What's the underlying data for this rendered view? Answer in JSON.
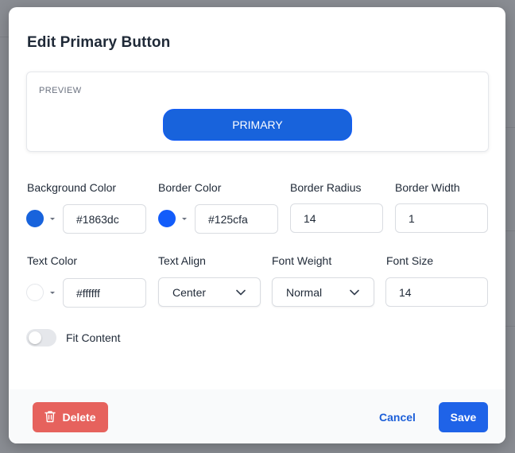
{
  "dialog": {
    "title": "Edit Primary Button"
  },
  "preview": {
    "label": "PREVIEW",
    "button_label": "PRIMARY"
  },
  "fields": {
    "background_color": {
      "label": "Background Color",
      "value": "#1863dc",
      "swatch": "#1863dc"
    },
    "border_color": {
      "label": "Border Color",
      "value": "#125cfa",
      "swatch": "#125cfa"
    },
    "border_radius": {
      "label": "Border Radius",
      "value": "14"
    },
    "border_width": {
      "label": "Border Width",
      "value": "1"
    },
    "text_color": {
      "label": "Text Color",
      "value": "#ffffff",
      "swatch": "#ffffff"
    },
    "text_align": {
      "label": "Text Align",
      "value": "Center"
    },
    "font_weight": {
      "label": "Font Weight",
      "value": "Normal"
    },
    "font_size": {
      "label": "Font Size",
      "value": "14"
    }
  },
  "fit_content": {
    "label": "Fit Content",
    "checked": false
  },
  "footer": {
    "delete_label": "Delete",
    "cancel_label": "Cancel",
    "save_label": "Save"
  },
  "colors": {
    "accent": "#1f63e8",
    "danger": "#e6625d"
  },
  "icons": {
    "delete": "trash-icon",
    "dropdown": "chevron-down-icon",
    "color_picker": "caret-down-icon"
  }
}
